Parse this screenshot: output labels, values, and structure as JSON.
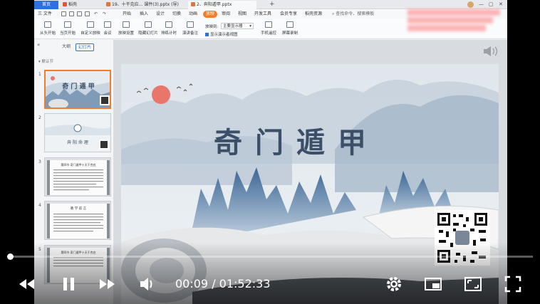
{
  "titlebar": {
    "tabs": [
      {
        "label": "首页"
      },
      {
        "label": "稻壳"
      },
      {
        "label": "19、十干克应... 课件(3).pptx (导)"
      },
      {
        "label": "2、奔阳遁甲.pptx"
      }
    ],
    "new_tab": "+"
  },
  "menubar": {
    "file_label": "三 文件",
    "items": [
      "开始",
      "插入",
      "设计",
      "切换",
      "动画",
      "放映",
      "审阅",
      "视图",
      "开发工具",
      "会员专享",
      "稻壳资源"
    ],
    "active_index": 5,
    "search_placeholder": "查找命令、搜索模板"
  },
  "ribbon": {
    "buttons": [
      "从头开始",
      "当页开始",
      "自定义放映",
      "会议",
      "放映设置",
      "隐藏幻灯片",
      "排练计时",
      "演讲备注",
      "手机遥控",
      "屏幕录制"
    ],
    "monitor_label": "放映到:",
    "monitor_value": "主要显示器",
    "presenter_label": "显示演示者视图"
  },
  "panel": {
    "tab_outline": "大纲",
    "tab_slides": "幻灯片",
    "section_label": "默认节",
    "slides": [
      {
        "num": "1",
        "title": "奇 门 遁 甲"
      },
      {
        "num": "2",
        "title": "奔 阳 命 理"
      },
      {
        "num": "3",
        "title": "第四节 奇门遁甲十天干克应"
      },
      {
        "num": "4",
        "title": "教 学 前 言"
      },
      {
        "num": "5",
        "title": "第四节 奇门遁甲十天干克应"
      }
    ]
  },
  "slide": {
    "title": "奇门遁甲"
  },
  "player": {
    "current_time": "00:09",
    "separator": " / ",
    "duration": "01:52:33",
    "progress_fraction": 0.0013
  },
  "colors": {
    "accent_orange": "#f47b2a",
    "brand_blue": "#2f6fde",
    "title_ink": "#3b4f68",
    "sun": "#e8766a"
  },
  "icons": [
    "rewind-icon",
    "pause-icon",
    "forward-icon",
    "volume-icon",
    "settings-icon",
    "miniplayer-icon",
    "theater-icon",
    "fullscreen-icon",
    "speaker-icon"
  ]
}
